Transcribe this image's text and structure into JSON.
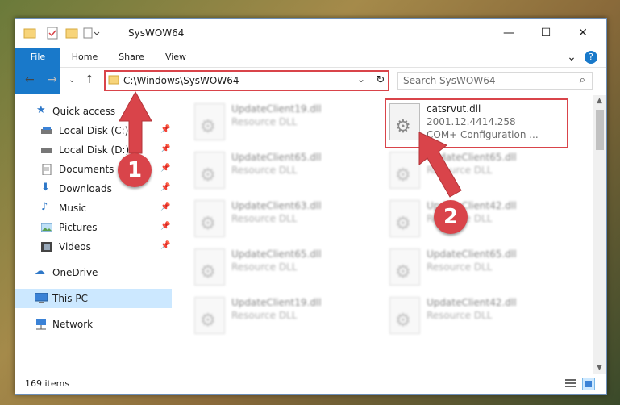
{
  "window": {
    "title": "SysWOW64",
    "controls": {
      "minimize": "—",
      "maximize": "☐",
      "close": "✕"
    }
  },
  "ribbon": {
    "tabs": [
      "File",
      "Home",
      "Share",
      "View"
    ],
    "help": "?"
  },
  "address": {
    "path": "C:\\Windows\\SysWOW64",
    "search_placeholder": "Search SysWOW64"
  },
  "nav": {
    "items": [
      {
        "label": "Quick access",
        "icon": "star-icon",
        "pinned": false
      },
      {
        "label": "Local Disk (C:)",
        "icon": "drive-icon",
        "pinned": true
      },
      {
        "label": "Local Disk (D:)",
        "icon": "drive-icon",
        "pinned": true
      },
      {
        "label": "Documents",
        "icon": "documents-icon",
        "pinned": true
      },
      {
        "label": "Downloads",
        "icon": "download-icon",
        "pinned": true
      },
      {
        "label": "Music",
        "icon": "music-icon",
        "pinned": true
      },
      {
        "label": "Pictures",
        "icon": "pictures-icon",
        "pinned": true
      },
      {
        "label": "Videos",
        "icon": "videos-icon",
        "pinned": true
      },
      {
        "label": "OneDrive",
        "icon": "cloud-icon",
        "pinned": false
      },
      {
        "label": "This PC",
        "icon": "pc-icon",
        "pinned": false,
        "selected": true
      },
      {
        "label": "Network",
        "icon": "network-icon",
        "pinned": false
      }
    ]
  },
  "files": {
    "highlighted": {
      "name": "catsrvut.dll",
      "version": "2001.12.4414.258",
      "type": "COM+ Configuration ..."
    },
    "left_column": [
      {
        "name": "UpdateClient19.dll",
        "type": "Resource DLL"
      },
      {
        "name": "UpdateClient65.dll",
        "type": "Resource DLL"
      },
      {
        "name": "UpdateClient63.dll",
        "type": "Resource DLL"
      },
      {
        "name": "UpdateClient65.dll",
        "type": "Resource DLL"
      },
      {
        "name": "UpdateClient19.dll",
        "type": "Resource DLL"
      }
    ],
    "right_column": [
      {
        "name": "UpdateClient65.dll",
        "type": "Resource DLL"
      },
      {
        "name": "UpdateClient42.dll",
        "type": "Resource DLL"
      },
      {
        "name": "UpdateClient65.dll",
        "type": "Resource DLL"
      },
      {
        "name": "UpdateClient42.dll",
        "type": "Resource DLL"
      }
    ]
  },
  "status": {
    "item_count": "169 items"
  },
  "annotations": {
    "step1": "1",
    "step2": "2",
    "color": "#d9444a"
  }
}
